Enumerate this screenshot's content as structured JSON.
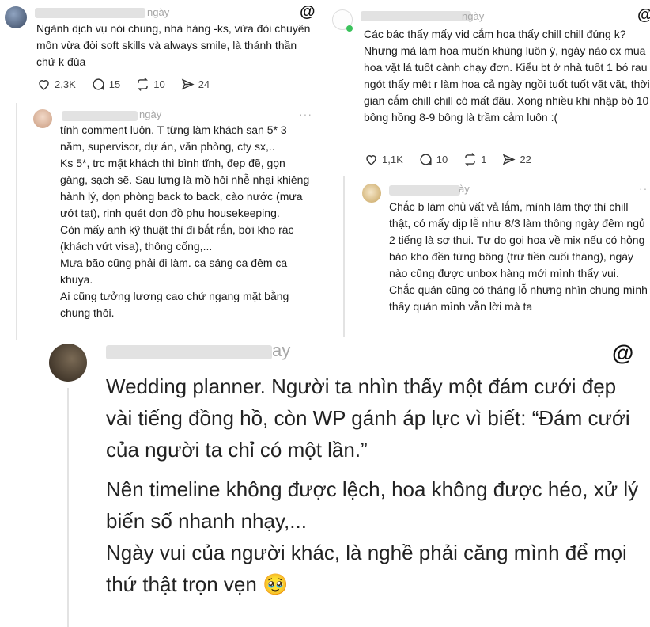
{
  "threads_logo": "@",
  "left": {
    "post": {
      "meta": "ngày",
      "text": "Ngành dịch vụ nói chung, nhà hàng -ks, vừa đòi chuyên môn vừa đòi soft skills và always smile, là thánh thần chứ k đùa",
      "likes": "2,3K",
      "comments": "15",
      "reposts": "10",
      "shares": "24"
    },
    "reply": {
      "meta": "ngày",
      "more": "···",
      "text": "tính comment luôn. T từng làm khách sạn 5* 3 năm, supervisor, dự án, văn phòng, cty sx,..\nKs 5*, trc mặt khách thì bình tĩnh, đẹp đẽ, gọn gàng, sạch sẽ. Sau lưng là mồ hôi nhễ nhại khiêng hành lý, dọn phòng back to back, cào nước (mưa ướt tạt), rinh quét dọn đồ phụ housekeeping.\nCòn mấy anh kỹ thuật thì đi bắt rắn, bới kho rác (khách vứt visa), thông cống,...\nMưa bão cũng phải đi làm. ca sáng ca đêm ca khuya.\nAi cũng tưởng lương cao chứ ngang mặt bằng chung thôi."
    }
  },
  "right": {
    "post": {
      "meta": "ngày",
      "text": "Các bác thấy mấy vid cắm hoa thấy chill chill đúng k?\nNhưng mà làm hoa muốn khùng luôn ý, ngày nào cx mua hoa vặt lá tuốt cành chạy đơn. Kiểu bt ở nhà tuốt 1 bó rau ngót thấy mệt r làm hoa cả ngày ngồi tuốt tuốt vặt vặt, thời gian cắm chill chill có mất đâu. Xong nhiều khi nhập bó 10 bông hồng 8-9 bông là trầm cảm luôn :(",
      "likes": "1,1K",
      "comments": "10",
      "reposts": "1",
      "shares": "22"
    },
    "reply": {
      "meta": "ày",
      "more": "··",
      "text": "Chắc b làm chủ vất vả lắm, mình làm thợ thì chill thật, có mấy dịp lễ như 8/3 làm thông ngày đêm ngủ 2 tiếng là sợ thui. Tự do gọi hoa về mix nếu có hỏng báo kho đền từng bông (trừ tiền cuối tháng), ngày nào cũng được unbox hàng mới mình thấy vui.\nChắc quán cũng có tháng lỗ nhưng nhìn chung mình thấy quán mình vẫn lời mà ta"
    }
  },
  "bottom": {
    "meta": "ay",
    "para1": "Wedding planner. Người ta nhìn thấy một đám cưới đẹp vài tiếng đồng hồ, còn WP gánh áp lực vì biết: “Đám cưới của người ta chỉ có một lần.”",
    "para2": "Nên timeline không được lệch, hoa không được héo, xử lý biến số nhanh nhạy,...\nNgày vui của người khác, là nghề phải căng mình để mọi thứ thật trọn vẹn 🥹"
  }
}
